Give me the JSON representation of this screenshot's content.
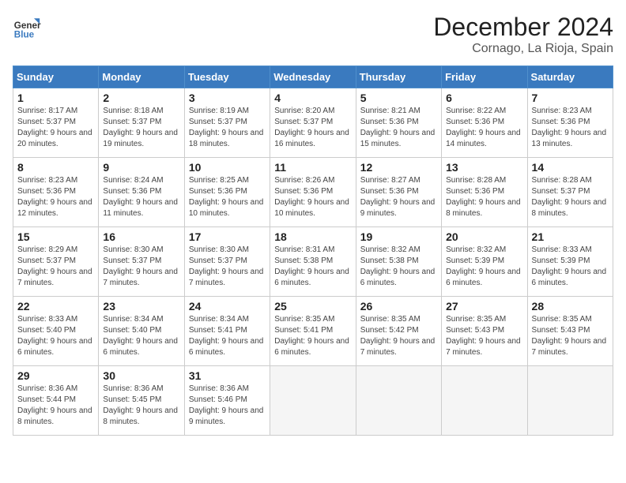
{
  "header": {
    "logo_line1": "General",
    "logo_line2": "Blue",
    "month_title": "December 2024",
    "location": "Cornago, La Rioja, Spain"
  },
  "weekdays": [
    "Sunday",
    "Monday",
    "Tuesday",
    "Wednesday",
    "Thursday",
    "Friday",
    "Saturday"
  ],
  "days": [
    {
      "day": "",
      "sunrise": "",
      "sunset": "",
      "daylight": ""
    },
    {
      "day": "",
      "sunrise": "",
      "sunset": "",
      "daylight": ""
    },
    {
      "day": "",
      "sunrise": "",
      "sunset": "",
      "daylight": ""
    },
    {
      "day": "",
      "sunrise": "",
      "sunset": "",
      "daylight": ""
    },
    {
      "day": "",
      "sunrise": "",
      "sunset": "",
      "daylight": ""
    },
    {
      "day": "",
      "sunrise": "",
      "sunset": "",
      "daylight": ""
    },
    {
      "day": "1",
      "sunrise": "Sunrise: 8:17 AM",
      "sunset": "Sunset: 5:37 PM",
      "daylight": "Daylight: 9 hours and 20 minutes."
    },
    {
      "day": "2",
      "sunrise": "Sunrise: 8:18 AM",
      "sunset": "Sunset: 5:37 PM",
      "daylight": "Daylight: 9 hours and 19 minutes."
    },
    {
      "day": "3",
      "sunrise": "Sunrise: 8:19 AM",
      "sunset": "Sunset: 5:37 PM",
      "daylight": "Daylight: 9 hours and 18 minutes."
    },
    {
      "day": "4",
      "sunrise": "Sunrise: 8:20 AM",
      "sunset": "Sunset: 5:37 PM",
      "daylight": "Daylight: 9 hours and 16 minutes."
    },
    {
      "day": "5",
      "sunrise": "Sunrise: 8:21 AM",
      "sunset": "Sunset: 5:36 PM",
      "daylight": "Daylight: 9 hours and 15 minutes."
    },
    {
      "day": "6",
      "sunrise": "Sunrise: 8:22 AM",
      "sunset": "Sunset: 5:36 PM",
      "daylight": "Daylight: 9 hours and 14 minutes."
    },
    {
      "day": "7",
      "sunrise": "Sunrise: 8:23 AM",
      "sunset": "Sunset: 5:36 PM",
      "daylight": "Daylight: 9 hours and 13 minutes."
    },
    {
      "day": "8",
      "sunrise": "Sunrise: 8:23 AM",
      "sunset": "Sunset: 5:36 PM",
      "daylight": "Daylight: 9 hours and 12 minutes."
    },
    {
      "day": "9",
      "sunrise": "Sunrise: 8:24 AM",
      "sunset": "Sunset: 5:36 PM",
      "daylight": "Daylight: 9 hours and 11 minutes."
    },
    {
      "day": "10",
      "sunrise": "Sunrise: 8:25 AM",
      "sunset": "Sunset: 5:36 PM",
      "daylight": "Daylight: 9 hours and 10 minutes."
    },
    {
      "day": "11",
      "sunrise": "Sunrise: 8:26 AM",
      "sunset": "Sunset: 5:36 PM",
      "daylight": "Daylight: 9 hours and 10 minutes."
    },
    {
      "day": "12",
      "sunrise": "Sunrise: 8:27 AM",
      "sunset": "Sunset: 5:36 PM",
      "daylight": "Daylight: 9 hours and 9 minutes."
    },
    {
      "day": "13",
      "sunrise": "Sunrise: 8:28 AM",
      "sunset": "Sunset: 5:36 PM",
      "daylight": "Daylight: 9 hours and 8 minutes."
    },
    {
      "day": "14",
      "sunrise": "Sunrise: 8:28 AM",
      "sunset": "Sunset: 5:37 PM",
      "daylight": "Daylight: 9 hours and 8 minutes."
    },
    {
      "day": "15",
      "sunrise": "Sunrise: 8:29 AM",
      "sunset": "Sunset: 5:37 PM",
      "daylight": "Daylight: 9 hours and 7 minutes."
    },
    {
      "day": "16",
      "sunrise": "Sunrise: 8:30 AM",
      "sunset": "Sunset: 5:37 PM",
      "daylight": "Daylight: 9 hours and 7 minutes."
    },
    {
      "day": "17",
      "sunrise": "Sunrise: 8:30 AM",
      "sunset": "Sunset: 5:37 PM",
      "daylight": "Daylight: 9 hours and 7 minutes."
    },
    {
      "day": "18",
      "sunrise": "Sunrise: 8:31 AM",
      "sunset": "Sunset: 5:38 PM",
      "daylight": "Daylight: 9 hours and 6 minutes."
    },
    {
      "day": "19",
      "sunrise": "Sunrise: 8:32 AM",
      "sunset": "Sunset: 5:38 PM",
      "daylight": "Daylight: 9 hours and 6 minutes."
    },
    {
      "day": "20",
      "sunrise": "Sunrise: 8:32 AM",
      "sunset": "Sunset: 5:39 PM",
      "daylight": "Daylight: 9 hours and 6 minutes."
    },
    {
      "day": "21",
      "sunrise": "Sunrise: 8:33 AM",
      "sunset": "Sunset: 5:39 PM",
      "daylight": "Daylight: 9 hours and 6 minutes."
    },
    {
      "day": "22",
      "sunrise": "Sunrise: 8:33 AM",
      "sunset": "Sunset: 5:40 PM",
      "daylight": "Daylight: 9 hours and 6 minutes."
    },
    {
      "day": "23",
      "sunrise": "Sunrise: 8:34 AM",
      "sunset": "Sunset: 5:40 PM",
      "daylight": "Daylight: 9 hours and 6 minutes."
    },
    {
      "day": "24",
      "sunrise": "Sunrise: 8:34 AM",
      "sunset": "Sunset: 5:41 PM",
      "daylight": "Daylight: 9 hours and 6 minutes."
    },
    {
      "day": "25",
      "sunrise": "Sunrise: 8:35 AM",
      "sunset": "Sunset: 5:41 PM",
      "daylight": "Daylight: 9 hours and 6 minutes."
    },
    {
      "day": "26",
      "sunrise": "Sunrise: 8:35 AM",
      "sunset": "Sunset: 5:42 PM",
      "daylight": "Daylight: 9 hours and 7 minutes."
    },
    {
      "day": "27",
      "sunrise": "Sunrise: 8:35 AM",
      "sunset": "Sunset: 5:43 PM",
      "daylight": "Daylight: 9 hours and 7 minutes."
    },
    {
      "day": "28",
      "sunrise": "Sunrise: 8:35 AM",
      "sunset": "Sunset: 5:43 PM",
      "daylight": "Daylight: 9 hours and 7 minutes."
    },
    {
      "day": "29",
      "sunrise": "Sunrise: 8:36 AM",
      "sunset": "Sunset: 5:44 PM",
      "daylight": "Daylight: 9 hours and 8 minutes."
    },
    {
      "day": "30",
      "sunrise": "Sunrise: 8:36 AM",
      "sunset": "Sunset: 5:45 PM",
      "daylight": "Daylight: 9 hours and 8 minutes."
    },
    {
      "day": "31",
      "sunrise": "Sunrise: 8:36 AM",
      "sunset": "Sunset: 5:46 PM",
      "daylight": "Daylight: 9 hours and 9 minutes."
    },
    {
      "day": "",
      "sunrise": "",
      "sunset": "",
      "daylight": ""
    },
    {
      "day": "",
      "sunrise": "",
      "sunset": "",
      "daylight": ""
    },
    {
      "day": "",
      "sunrise": "",
      "sunset": "",
      "daylight": ""
    },
    {
      "day": "",
      "sunrise": "",
      "sunset": "",
      "daylight": ""
    },
    {
      "day": "",
      "sunrise": "",
      "sunset": "",
      "daylight": ""
    }
  ]
}
